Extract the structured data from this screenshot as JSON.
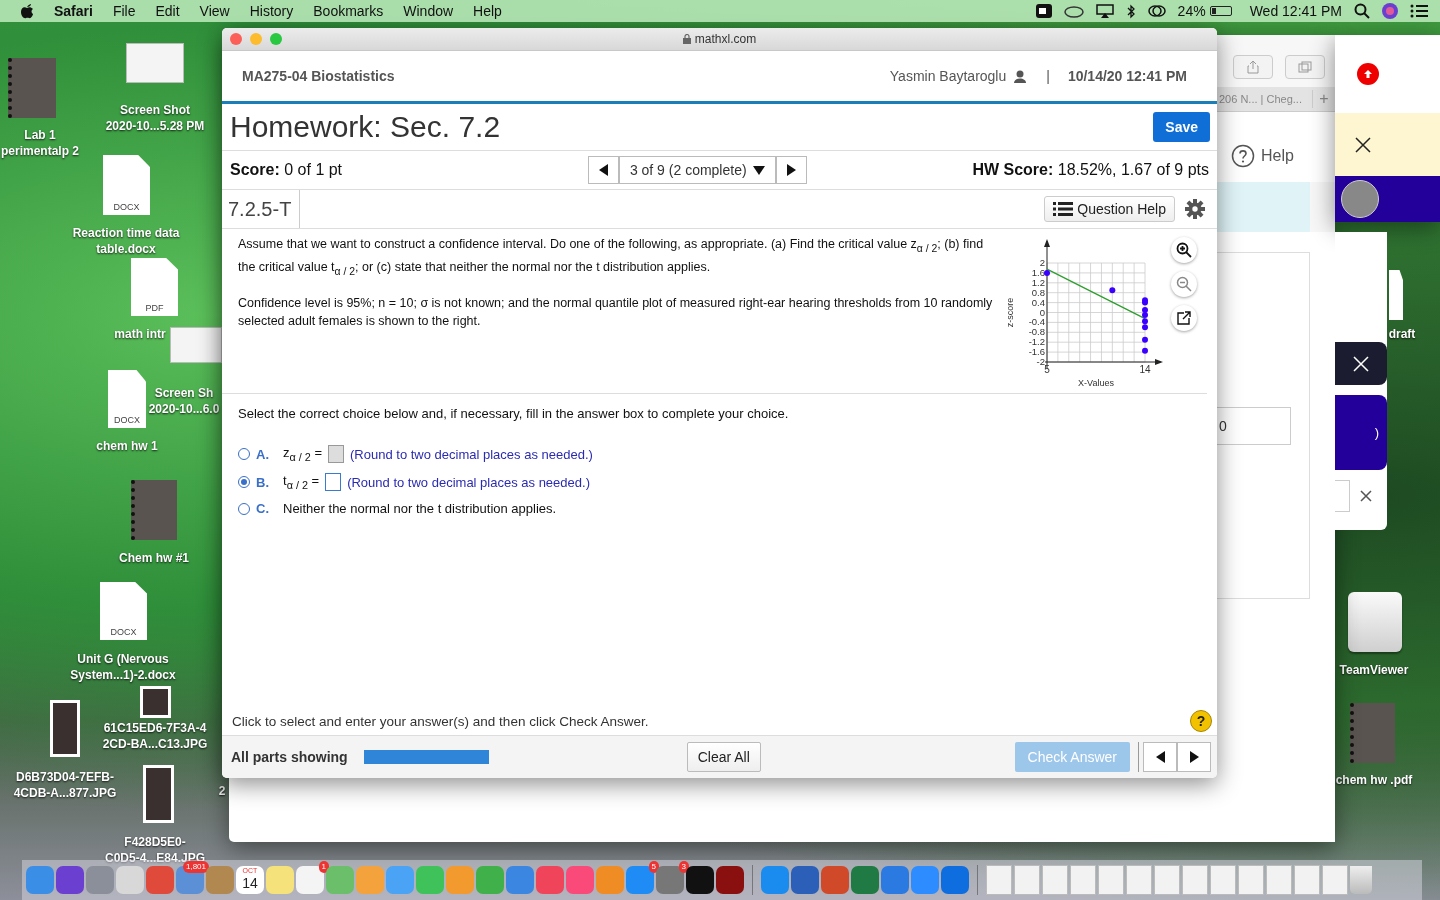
{
  "menu_bar": {
    "app": "Safari",
    "menus": [
      "File",
      "Edit",
      "View",
      "History",
      "Bookmarks",
      "Window",
      "Help"
    ],
    "battery": {
      "reading": "24%",
      "level": 0.24
    },
    "clock": "Wed 12:41 PM"
  },
  "desktop_icons": [
    {
      "kind": "notebook",
      "label": [
        "Lab 1",
        "perimentalp 2"
      ]
    },
    {
      "kind": "screenshot",
      "label": [
        "Screen Shot",
        "2020-10...5.28 PM"
      ]
    },
    {
      "kind": "document",
      "file_type": "DOCX",
      "label": [
        "Reaction time data",
        "table.docx"
      ]
    },
    {
      "kind": "document",
      "file_type": "PDF",
      "label": [
        "math intr"
      ]
    },
    {
      "kind": "document",
      "file_type": "DOCX",
      "label": [
        "chem hw 1"
      ]
    },
    {
      "kind": "screenshot",
      "label": [
        "Screen Sh",
        "2020-10...6.0"
      ]
    },
    {
      "kind": "notebook",
      "label": [
        "Chem hw #1"
      ]
    },
    {
      "kind": "document",
      "file_type": "DOCX",
      "label": [
        "Unit G (Nervous",
        "System...1)-2.docx"
      ]
    },
    {
      "kind": "photo",
      "label": [
        "61C15ED6-7F3A-4",
        "2CD-BA...C13.JPG"
      ]
    },
    {
      "kind": "photo",
      "label": [
        "D6B73D04-7EFB-",
        "4CDB-A...877.JPG"
      ]
    },
    {
      "kind": "photo",
      "label": [
        "F428D5E0-",
        "C0D5-4...E84.JPG"
      ]
    },
    {
      "kind": "none",
      "label": [
        "2"
      ]
    },
    {
      "kind": "document",
      "label": [
        "draft"
      ]
    },
    {
      "kind": "drive",
      "label": [
        "TeamViewer"
      ]
    },
    {
      "kind": "notebook",
      "label": [
        "chem hw .pdf"
      ]
    }
  ],
  "back_window": {
    "tab": "206 N... | Cheg...",
    "new_tab": "+",
    "help": "Help",
    "field_value": "0"
  },
  "side_window": {
    "toast_text": ")"
  },
  "browser": {
    "address": "mathxl.com",
    "course": "MA275-04 Biostatistics",
    "user": "Yasmin Baytaroglu",
    "separator": "|",
    "datetime": "10/14/20 12:41 PM",
    "title": "Homework: Sec. 7.2",
    "save": "Save",
    "score": "**Score:** 0 of 1 pt",
    "nav": "3 of 9 (2 complete)",
    "hw_score": "**HW Score:** 18.52%, 1.67 of 9 pts",
    "question_id": "7.2.5-T",
    "question_help": "Question Help",
    "question": [
      "Assume that we want to construct a confidence interval. Do one of the following, as appropriate. (a) Find the critical value z$_{α / 2}$; (b) find the critical value t$_{α / 2}$; or (c) state that neither the normal nor the t distribution applies.",
      "Confidence level is 95%; n = 10; σ is not known; and the normal quantile plot of measured right-ear hearing thresholds from 10 randomly selected adult females is shown to the right."
    ],
    "chart_data": {
      "type": "scatter",
      "xlabel": "X-Values",
      "ylabel": "z-score",
      "xlim": [
        5,
        14
      ],
      "ylim": [
        -2,
        2
      ],
      "xticks": [
        5,
        14
      ],
      "grid": true,
      "yticks": [
        2,
        1.6,
        1.2,
        0.8,
        0.4,
        0,
        -0.4,
        -0.8,
        -1.2,
        -1.6,
        -2
      ],
      "x": [
        5,
        11,
        14,
        14,
        14,
        14,
        14,
        14,
        14,
        14
      ],
      "series": [
        {
          "color": "#3a00ff",
          "values": [
            1.6,
            0.9,
            0.5,
            0.4,
            0.1,
            -0.1,
            -0.35,
            -0.6,
            -1.1,
            -1.55
          ]
        },
        {
          "type": "line",
          "color": "#2e9e2e",
          "values": [
            1.75,
            0.42,
            -0.25,
            null,
            null,
            null,
            null,
            null,
            null,
            null
          ]
        }
      ]
    },
    "instruction": "Select the correct choice below and, if necessary, fill in the answer box to complete your choice.",
    "choices": [
      {
        "letter": "A.",
        "kind": "answer_box",
        "symbol": "z$_{α / 2}$ =",
        "hint": "(Round to two decimal places as needed.)",
        "selected": false,
        "disabled": true
      },
      {
        "letter": "B.",
        "kind": "answer_box",
        "symbol": "t$_{α / 2}$ =",
        "hint": "(Round to two decimal places as needed.)",
        "selected": true,
        "disabled": false
      },
      {
        "letter": "C.",
        "kind": "text",
        "text": "Neither the normal nor the t distribution applies.",
        "selected": false
      }
    ],
    "footer_hint": "Click to select and enter your answer(s) and then click Check Answer.",
    "help_mark": "?",
    "parts": "All parts showing",
    "parts_progress": {
      "level": 1
    },
    "clear": "Clear All",
    "check": "Check Answer",
    "check_disabled": true
  },
  "dock": [
    {
      "kind": "app",
      "color": "#3a8ee6"
    },
    {
      "kind": "app",
      "color": "#6b3fd0"
    },
    {
      "kind": "app",
      "color": "#8a8f99"
    },
    {
      "kind": "app",
      "color": "#d8d8d8"
    },
    {
      "kind": "app",
      "color": "#e04a3a"
    },
    {
      "kind": "app",
      "color": "#5b8fd6",
      "badge": "1,801"
    },
    {
      "kind": "app",
      "color": "#b08850"
    },
    {
      "kind": "calendar",
      "month": "OCT",
      "day": "14"
    },
    {
      "kind": "app",
      "color": "#f5e27a"
    },
    {
      "kind": "app",
      "color": "#f4f4f4",
      "badge": "1"
    },
    {
      "kind": "app",
      "color": "#6cbf6a"
    },
    {
      "kind": "app",
      "color": "#f4a23c"
    },
    {
      "kind": "app",
      "color": "#4aa3f5"
    },
    {
      "kind": "app",
      "color": "#3fc25a"
    },
    {
      "kind": "app",
      "color": "#f29a2e"
    },
    {
      "kind": "app",
      "color": "#3fb04a"
    },
    {
      "kind": "app",
      "color": "#3a86e0"
    },
    {
      "kind": "app",
      "color": "#f0445a"
    },
    {
      "kind": "app",
      "color": "#fa4a7a"
    },
    {
      "kind": "app",
      "color": "#f08c24"
    },
    {
      "kind": "app",
      "color": "#1e8cf4",
      "badge": "5"
    },
    {
      "kind": "app",
      "color": "#777777",
      "badge": "3"
    },
    {
      "kind": "app",
      "color": "#111111"
    },
    {
      "kind": "app",
      "color": "#8a1010"
    },
    {
      "kind": "separator"
    },
    {
      "kind": "app",
      "color": "#1a8cf0"
    },
    {
      "kind": "app",
      "color": "#2b5fb8"
    },
    {
      "kind": "app",
      "color": "#d04a2a"
    },
    {
      "kind": "app",
      "color": "#1f7a43"
    },
    {
      "kind": "app",
      "color": "#2a7ae2"
    },
    {
      "kind": "app",
      "color": "#2d8cff"
    },
    {
      "kind": "app",
      "color": "#0e6ee0"
    },
    {
      "kind": "separator"
    },
    {
      "kind": "document"
    },
    {
      "kind": "document"
    },
    {
      "kind": "document"
    },
    {
      "kind": "document"
    },
    {
      "kind": "document"
    },
    {
      "kind": "document"
    },
    {
      "kind": "document"
    },
    {
      "kind": "document"
    },
    {
      "kind": "document"
    },
    {
      "kind": "document"
    },
    {
      "kind": "document"
    },
    {
      "kind": "document"
    },
    {
      "kind": "document"
    },
    {
      "kind": "trash"
    }
  ]
}
